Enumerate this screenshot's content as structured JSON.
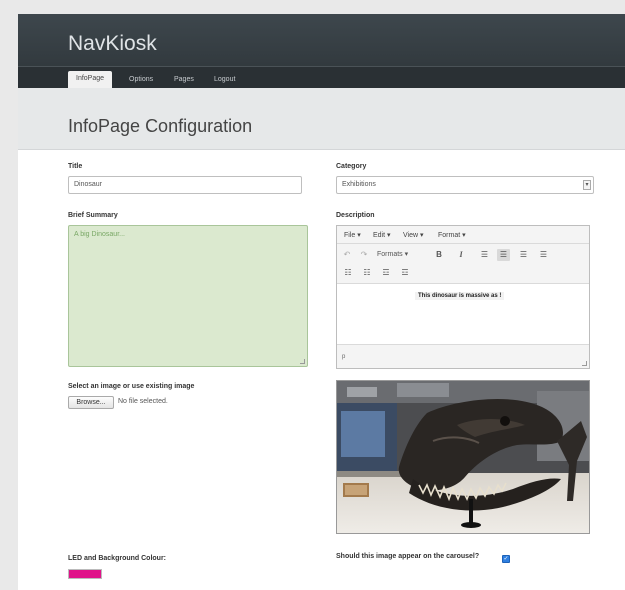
{
  "app": {
    "brand": "NavKiosk",
    "nav": [
      {
        "label": "InfoPage"
      },
      {
        "label": "Options"
      },
      {
        "label": "Pages"
      },
      {
        "label": "Logout"
      }
    ]
  },
  "page": {
    "title": "InfoPage Configuration"
  },
  "form": {
    "title_label": "Title",
    "title_value": "Dinosaur",
    "category_label": "Category",
    "category_value": "Exhibitions",
    "summary_label": "Brief Summary",
    "summary_value": "A big Dinosaur...",
    "description_label": "Description",
    "editor": {
      "menu": [
        "File",
        "Edit",
        "View",
        "Format"
      ],
      "formats_label": "Formats",
      "content": "This dinosaur is massive as !",
      "path": "p"
    },
    "image_label": "Select an image or use existing image",
    "browse_label": "Browse...",
    "no_file_text": "No file selected.",
    "colour_label": "LED and Background Colour:",
    "colour_value": "#e0138a",
    "carousel_label": "Should this image appear on the carousel?",
    "carousel_checked": true
  },
  "icons": {
    "undo": "undo-icon",
    "redo": "redo-icon",
    "bold": "bold-icon",
    "italic": "italic-icon",
    "align_left": "align-left-icon",
    "align_center": "align-center-icon",
    "align_right": "align-right-icon",
    "justify": "justify-icon",
    "bullet_list": "bullet-list-icon",
    "number_list": "number-list-icon",
    "outdent": "outdent-icon",
    "indent": "indent-icon",
    "checkmark": "checkmark-icon"
  }
}
